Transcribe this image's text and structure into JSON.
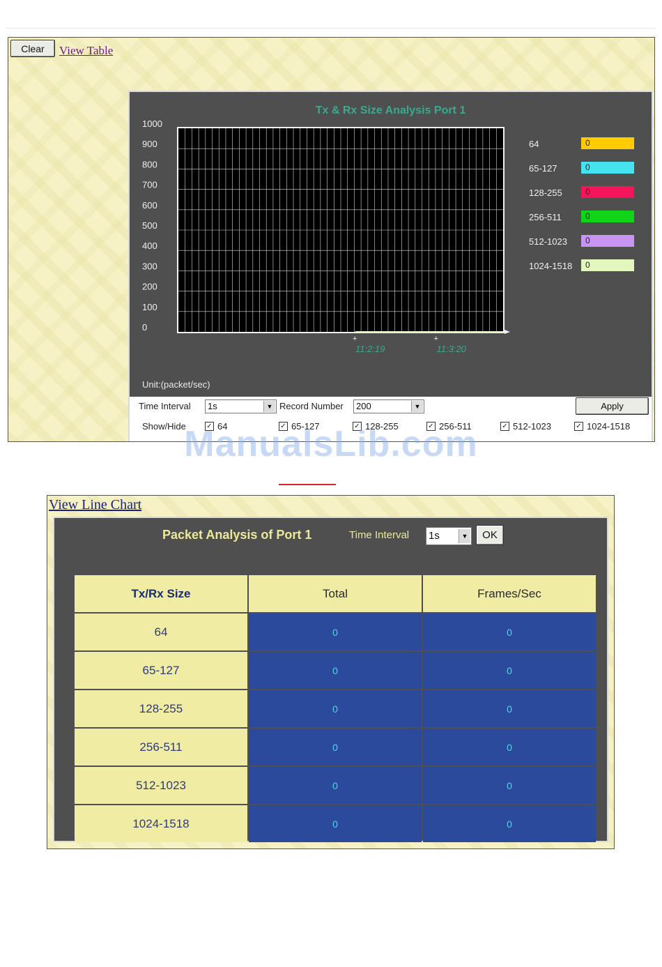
{
  "top": {
    "clear_label": "Clear",
    "view_table_label": "View Table"
  },
  "line_chart": {
    "title": "Tx & Rx Size Analysis   Port 1",
    "unit_label": "Unit:(packet/sec)",
    "y_ticks": [
      "1000",
      "900",
      "800",
      "700",
      "600",
      "500",
      "400",
      "300",
      "200",
      "100",
      "0"
    ],
    "x_ticks": [
      "11:2:19",
      "11:3:20"
    ],
    "legend": [
      {
        "label": "64",
        "value": "0",
        "color": "#ffcc00"
      },
      {
        "label": "65-127",
        "value": "0",
        "color": "#44e3ef"
      },
      {
        "label": "128-255",
        "value": "0",
        "color": "#f4155a"
      },
      {
        "label": "256-511",
        "value": "0",
        "color": "#10d418"
      },
      {
        "label": "512-1023",
        "value": "0",
        "color": "#c995f2"
      },
      {
        "label": "1024-1518",
        "value": "0",
        "color": "#e2f6be"
      }
    ]
  },
  "chart_data": {
    "type": "line",
    "title": "Tx & Rx Size Analysis   Port 1",
    "xlabel": "",
    "ylabel": "Unit:(packet/sec)",
    "ylim": [
      0,
      1000
    ],
    "x": [
      "11:2:19",
      "11:3:20"
    ],
    "series": [
      {
        "name": "64",
        "values": [
          0,
          0
        ]
      },
      {
        "name": "65-127",
        "values": [
          0,
          0
        ]
      },
      {
        "name": "128-255",
        "values": [
          0,
          0
        ]
      },
      {
        "name": "256-511",
        "values": [
          0,
          0
        ]
      },
      {
        "name": "512-1023",
        "values": [
          0,
          0
        ]
      },
      {
        "name": "1024-1518",
        "values": [
          0,
          0
        ]
      }
    ],
    "grid": true,
    "legend": "right"
  },
  "controls": {
    "time_interval_label": "Time Interval",
    "time_interval_value": "1s",
    "record_number_label": "Record Number",
    "record_number_value": "200",
    "apply_label": "Apply",
    "show_hide_label": "Show/Hide",
    "checkboxes": [
      {
        "label": "64",
        "checked": "✓"
      },
      {
        "label": "65-127",
        "checked": "✓"
      },
      {
        "label": "128-255",
        "checked": "✓"
      },
      {
        "label": "256-511",
        "checked": "✓"
      },
      {
        "label": "512-1023",
        "checked": "✓"
      },
      {
        "label": "1024-1518",
        "checked": "✓"
      }
    ]
  },
  "watermark": "ManualsLib.com",
  "table_view": {
    "view_line_chart_label": "View Line Chart",
    "title": "Packet Analysis of Port 1",
    "time_interval_label": "Time Interval",
    "time_interval_value": "1s",
    "ok_label": "OK",
    "headers": [
      "Tx/Rx Size",
      "Total",
      "Frames/Sec"
    ],
    "rows": [
      {
        "size": "64",
        "total": "0",
        "fps": "0"
      },
      {
        "size": "65-127",
        "total": "0",
        "fps": "0"
      },
      {
        "size": "128-255",
        "total": "0",
        "fps": "0"
      },
      {
        "size": "256-511",
        "total": "0",
        "fps": "0"
      },
      {
        "size": "512-1023",
        "total": "0",
        "fps": "0"
      },
      {
        "size": "1024-1518",
        "total": "0",
        "fps": "0"
      }
    ]
  }
}
